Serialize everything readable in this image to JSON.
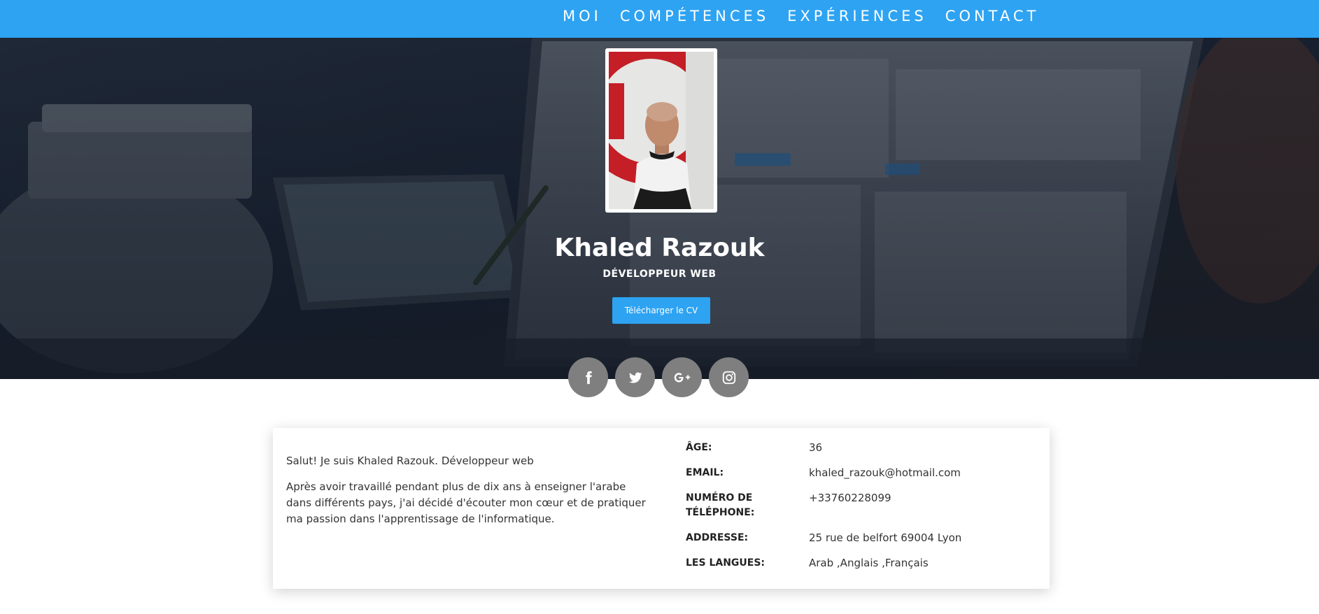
{
  "colors": {
    "nav_bg": "#2ea3f2",
    "button_bg": "#2ea3f2",
    "social_bg": "#7f7f7f"
  },
  "nav": {
    "items": [
      "MOI",
      "COMPÉTENCES",
      "EXPÉRIENCES",
      "CONTACT"
    ]
  },
  "hero": {
    "name": "Khaled Razouk",
    "role": "DÉVELOPPEUR WEB",
    "cv_button": "Télécharger le CV"
  },
  "social": [
    "facebook-icon",
    "twitter-icon",
    "google-plus-icon",
    "instagram-icon"
  ],
  "about": {
    "intro": "Salut! Je suis Khaled Razouk. Développeur web",
    "paragraph": "Après avoir travaillé pendant plus de dix ans à enseigner l'arabe dans différents pays, j'ai décidé d'écouter mon cœur et de pratiquer ma passion dans l'apprentissage de l'informatique."
  },
  "info": [
    {
      "label": "ÂGE:",
      "value": "36"
    },
    {
      "label": "EMAIL:",
      "value": "khaled_razouk@hotmail.com"
    },
    {
      "label": "NUMÉRO DE TÉLÉPHONE:",
      "value": "+33760228099"
    },
    {
      "label": "ADDRESSE:",
      "value": "25 rue de belfort 69004 Lyon"
    },
    {
      "label": "LES LANGUES:",
      "value": "Arab ,Anglais ,Français"
    }
  ]
}
